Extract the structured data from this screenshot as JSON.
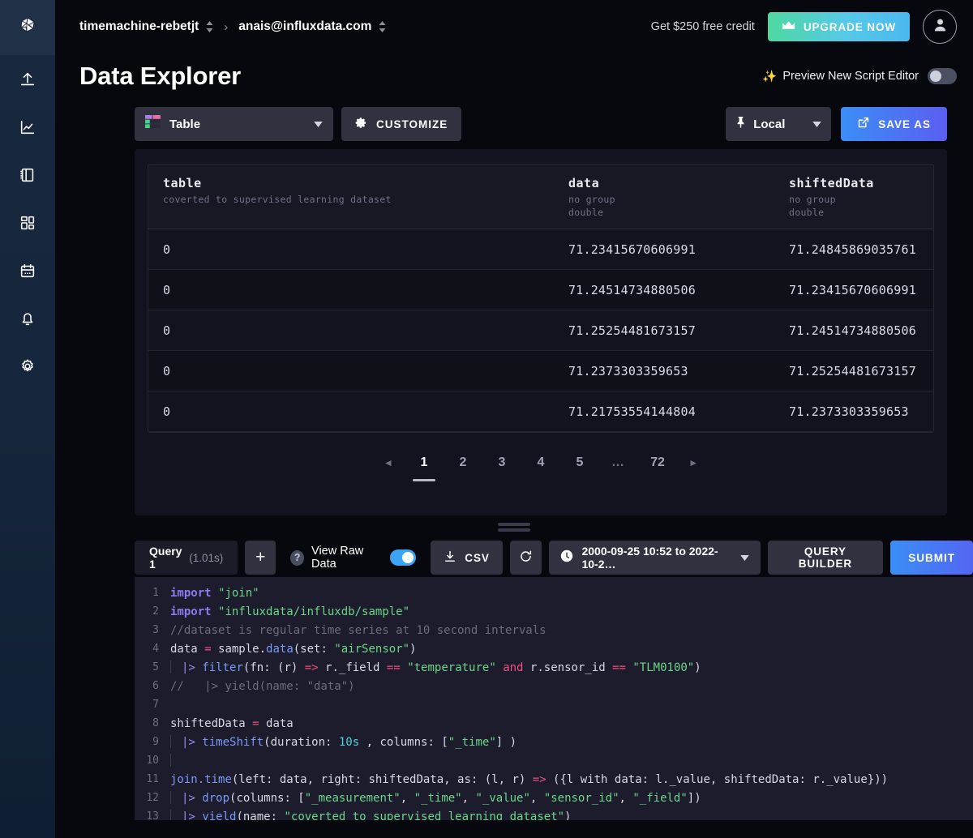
{
  "sidebar": {
    "logo_name": "influxdata-logo",
    "items": [
      {
        "icon": "upload-icon",
        "label": "Load Data"
      },
      {
        "icon": "line-graph-icon",
        "label": "Data Explorer"
      },
      {
        "icon": "notebook-icon",
        "label": "Notebooks"
      },
      {
        "icon": "dashboard-grid-icon",
        "label": "Dashboards"
      },
      {
        "icon": "calendar-tasks-icon",
        "label": "Tasks"
      },
      {
        "icon": "bell-alerts-icon",
        "label": "Alerts"
      },
      {
        "icon": "gear-settings-icon",
        "label": "Settings"
      }
    ]
  },
  "header": {
    "org_name": "timemachine-rebetjt",
    "separator": "›",
    "user_email": "anais@influxdata.com",
    "credit_text": "Get $250 free credit",
    "upgrade_label": "UPGRADE NOW",
    "upgrade_icon": "crown-icon",
    "avatar_icon": "user-avatar-icon"
  },
  "page": {
    "title": "Data Explorer",
    "preview_sparkle": "✨",
    "preview_label": "Preview New Script Editor",
    "preview_toggle_on": false
  },
  "viz_toolbar": {
    "viz_type": "Table",
    "viz_type_icon": "table-grid-icon",
    "customize_label": "CUSTOMIZE",
    "customize_icon": "gear-icon",
    "local_label": "Local",
    "local_icon": "pin-icon",
    "save_as_label": "SAVE AS",
    "save_as_icon": "external-link-icon"
  },
  "table": {
    "columns": [
      {
        "name": "table",
        "sub1": "coverted to supervised learning dataset",
        "sub2": ""
      },
      {
        "name": "data",
        "sub1": "no group",
        "sub2": "double"
      },
      {
        "name": "shiftedData",
        "sub1": "no group",
        "sub2": "double"
      }
    ],
    "rows": [
      [
        "0",
        "71.23415670606991",
        "71.24845869035761"
      ],
      [
        "0",
        "71.24514734880506",
        "71.23415670606991"
      ],
      [
        "0",
        "71.25254481673157",
        "71.24514734880506"
      ],
      [
        "0",
        "71.2373303359653",
        "71.25254481673157"
      ],
      [
        "0",
        "71.21753554144804",
        "71.2373303359653"
      ]
    ]
  },
  "pagination": {
    "prev": "◂",
    "next": "▸",
    "pages": [
      "1",
      "2",
      "3",
      "4",
      "5"
    ],
    "ellipsis": "…",
    "last_page": "72",
    "active_page": "1"
  },
  "query_bar": {
    "tab_name": "Query 1",
    "tab_time": "(1.01s)",
    "add_label": "+",
    "help_glyph": "?",
    "raw_data_label": "View Raw Data",
    "raw_data_on": true,
    "csv_label": "CSV",
    "csv_icon": "download-icon",
    "refresh_icon": "refresh-icon",
    "time_range": "2000-09-25 10:52 to 2022-10-2…",
    "time_icon": "clock-icon",
    "query_builder_label": "QUERY BUILDER",
    "submit_label": "SUBMIT"
  },
  "editor": {
    "lines": [
      {
        "n": "1",
        "tokens": [
          {
            "t": "import ",
            "c": "k-import"
          },
          {
            "t": "\"join\"",
            "c": "k-str"
          }
        ]
      },
      {
        "n": "2",
        "tokens": [
          {
            "t": "import ",
            "c": "k-import"
          },
          {
            "t": "\"influxdata/influxdb/sample\"",
            "c": "k-str"
          }
        ]
      },
      {
        "n": "3",
        "tokens": [
          {
            "t": "//dataset is regular time series at 10 second intervals",
            "c": "k-com"
          }
        ]
      },
      {
        "n": "4",
        "tokens": [
          {
            "t": "data ",
            "c": ""
          },
          {
            "t": "= ",
            "c": "k-op"
          },
          {
            "t": "sample.",
            "c": ""
          },
          {
            "t": "data",
            "c": "k-fn"
          },
          {
            "t": "(set: ",
            "c": ""
          },
          {
            "t": "\"airSensor\"",
            "c": "k-str"
          },
          {
            "t": ")",
            "c": ""
          }
        ]
      },
      {
        "n": "5",
        "indent": 1,
        "tokens": [
          {
            "t": "|> ",
            "c": "k-pipe"
          },
          {
            "t": "filter",
            "c": "k-fn"
          },
          {
            "t": "(fn: (r) ",
            "c": ""
          },
          {
            "t": "=> ",
            "c": "k-op"
          },
          {
            "t": "r._field ",
            "c": ""
          },
          {
            "t": "== ",
            "c": "k-op"
          },
          {
            "t": "\"temperature\" ",
            "c": "k-str"
          },
          {
            "t": "and ",
            "c": "k-op"
          },
          {
            "t": "r.sensor_id ",
            "c": ""
          },
          {
            "t": "== ",
            "c": "k-op"
          },
          {
            "t": "\"TLM0100\"",
            "c": "k-str"
          },
          {
            "t": ")",
            "c": ""
          }
        ]
      },
      {
        "n": "6",
        "tokens": [
          {
            "t": "//",
            "c": "k-com"
          },
          {
            "t": "   |> yield(name: \"data\")",
            "c": "k-com"
          }
        ]
      },
      {
        "n": "7",
        "tokens": []
      },
      {
        "n": "8",
        "tokens": [
          {
            "t": "shiftedData ",
            "c": ""
          },
          {
            "t": "= ",
            "c": "k-op"
          },
          {
            "t": "data",
            "c": ""
          }
        ]
      },
      {
        "n": "9",
        "indent": 1,
        "tokens": [
          {
            "t": "|> ",
            "c": "k-pipe"
          },
          {
            "t": "timeShift",
            "c": "k-fn"
          },
          {
            "t": "(duration: ",
            "c": ""
          },
          {
            "t": "10s",
            "c": "k-num"
          },
          {
            "t": " , columns: [",
            "c": ""
          },
          {
            "t": "\"_time\"",
            "c": "k-str"
          },
          {
            "t": "] )",
            "c": ""
          }
        ]
      },
      {
        "n": "10",
        "indent": 1,
        "tokens": []
      },
      {
        "n": "11",
        "tokens": [
          {
            "t": "join.",
            "c": "k-fn"
          },
          {
            "t": "time",
            "c": "k-fn"
          },
          {
            "t": "(left: data, right: shiftedData, as: (l, r) ",
            "c": ""
          },
          {
            "t": "=> ",
            "c": "k-op"
          },
          {
            "t": "({l with data: l._value, shiftedData: r._value}))",
            "c": ""
          }
        ]
      },
      {
        "n": "12",
        "indent": 1,
        "tokens": [
          {
            "t": "|> ",
            "c": "k-pipe"
          },
          {
            "t": "drop",
            "c": "k-fn"
          },
          {
            "t": "(columns: [",
            "c": ""
          },
          {
            "t": "\"_measurement\"",
            "c": "k-str"
          },
          {
            "t": ", ",
            "c": ""
          },
          {
            "t": "\"_time\"",
            "c": "k-str"
          },
          {
            "t": ", ",
            "c": ""
          },
          {
            "t": "\"_value\"",
            "c": "k-str"
          },
          {
            "t": ", ",
            "c": ""
          },
          {
            "t": "\"sensor_id\"",
            "c": "k-str"
          },
          {
            "t": ", ",
            "c": ""
          },
          {
            "t": "\"_field\"",
            "c": "k-str"
          },
          {
            "t": "])",
            "c": ""
          }
        ]
      },
      {
        "n": "13",
        "indent": 1,
        "tokens": [
          {
            "t": "|> ",
            "c": "k-pipe"
          },
          {
            "t": "yield",
            "c": "k-fn"
          },
          {
            "t": "(name: ",
            "c": ""
          },
          {
            "t": "\"coverted to supervised learning dataset\"",
            "c": "k-str"
          },
          {
            "t": ")",
            "c": ""
          }
        ]
      }
    ]
  },
  "colors": {
    "nav_bg": "#16263c",
    "panel_bg": "#13131f",
    "control_bg": "#31313f",
    "accent_blue": "#3a8ef6",
    "accent_green": "#4ed8a0",
    "toggle_on": "#3ba4f5"
  }
}
